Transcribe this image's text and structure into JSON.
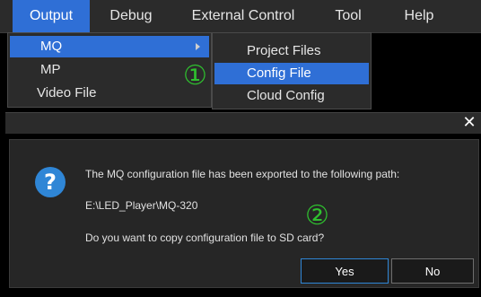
{
  "menubar": {
    "items": [
      {
        "label": "Output"
      },
      {
        "label": "Debug"
      },
      {
        "label": "External Control"
      },
      {
        "label": "Tool"
      },
      {
        "label": "Help"
      }
    ]
  },
  "output_menu": {
    "items": [
      {
        "label": "MQ"
      },
      {
        "label": "MP"
      },
      {
        "label": "Video File"
      }
    ]
  },
  "mq_submenu": {
    "items": [
      {
        "label": "Project Files"
      },
      {
        "label": "Config File"
      },
      {
        "label": "Cloud Config"
      }
    ]
  },
  "annotations": {
    "one": "①",
    "two": "②"
  },
  "dialog": {
    "close_glyph": "✕",
    "icon_glyph": "?",
    "message": "The MQ configuration file has been exported to the following path:",
    "path": "E:\\LED_Player\\MQ-320",
    "question": "Do you want to copy configuration file to SD card?",
    "yes_label": "Yes",
    "no_label": "No"
  },
  "colors": {
    "accent": "#2f6fd6",
    "annotation": "#2fc02f",
    "background": "#000000"
  }
}
